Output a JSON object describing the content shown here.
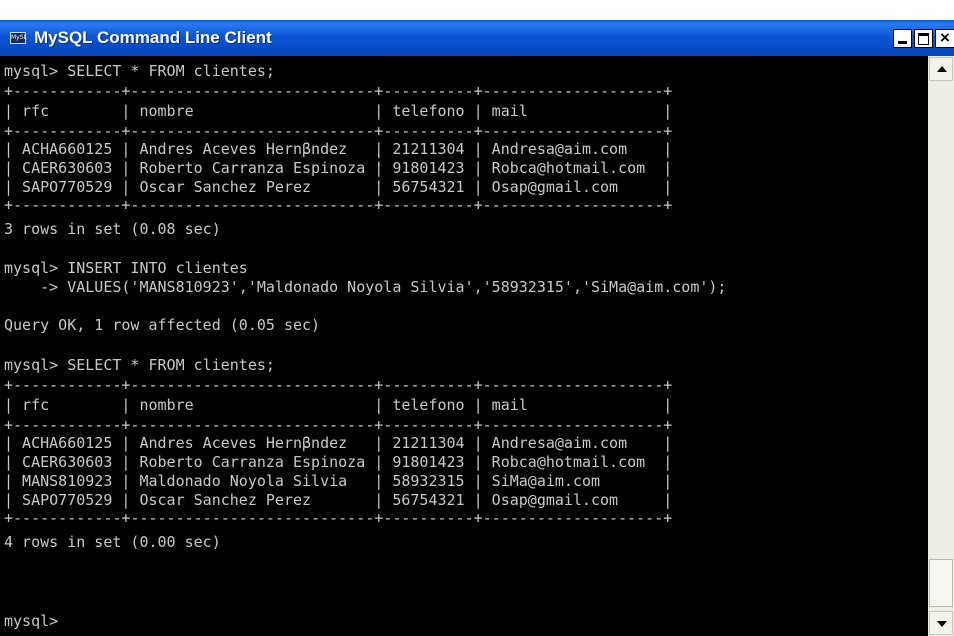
{
  "window": {
    "title": "MySQL Command Line Client",
    "icon_label": "MySL"
  },
  "console": {
    "lines": [
      "mysql> SELECT * FROM clientes;",
      "+------------+---------------------------+----------+--------------------+",
      "| rfc        | nombre                    | telefono | mail               |",
      "+------------+---------------------------+----------+--------------------+",
      "| ACHA660125 | Andres Aceves Hernβndez   | 21211304 | Andresa@aim.com    |",
      "| CAER630603 | Roberto Carranza Espinoza | 91801423 | Robca@hotmail.com  |",
      "| SAPO770529 | Oscar Sanchez Perez       | 56754321 | Osap@gmail.com     |",
      "+------------+---------------------------+----------+--------------------+",
      "3 rows in set (0.08 sec)",
      "",
      "mysql> INSERT INTO clientes",
      "    -> VALUES('MANS810923','Maldonado Noyola Silvia','58932315','SiMa@aim.com');",
      "Query OK, 1 row affected (0.05 sec)",
      "",
      "mysql> SELECT * FROM clientes;",
      "+------------+---------------------------+----------+--------------------+",
      "| rfc        | nombre                    | telefono | mail               |",
      "+------------+---------------------------+----------+--------------------+",
      "| ACHA660125 | Andres Aceves Hernβndez   | 21211304 | Andresa@aim.com    |",
      "| CAER630603 | Roberto Carranza Espinoza | 91801423 | Robca@hotmail.com  |",
      "| MANS810923 | Maldonado Noyola Silvia   | 58932315 | SiMa@aim.com       |",
      "| SAPO770529 | Oscar Sanchez Perez       | 56754321 | Osap@gmail.com     |",
      "+------------+---------------------------+----------+--------------------+",
      "4 rows in set (0.00 sec)",
      "",
      "mysql>"
    ]
  },
  "colors": {
    "titlebar": "#0a55d6",
    "console_bg": "#000000",
    "console_text": "#c8c8c8"
  }
}
